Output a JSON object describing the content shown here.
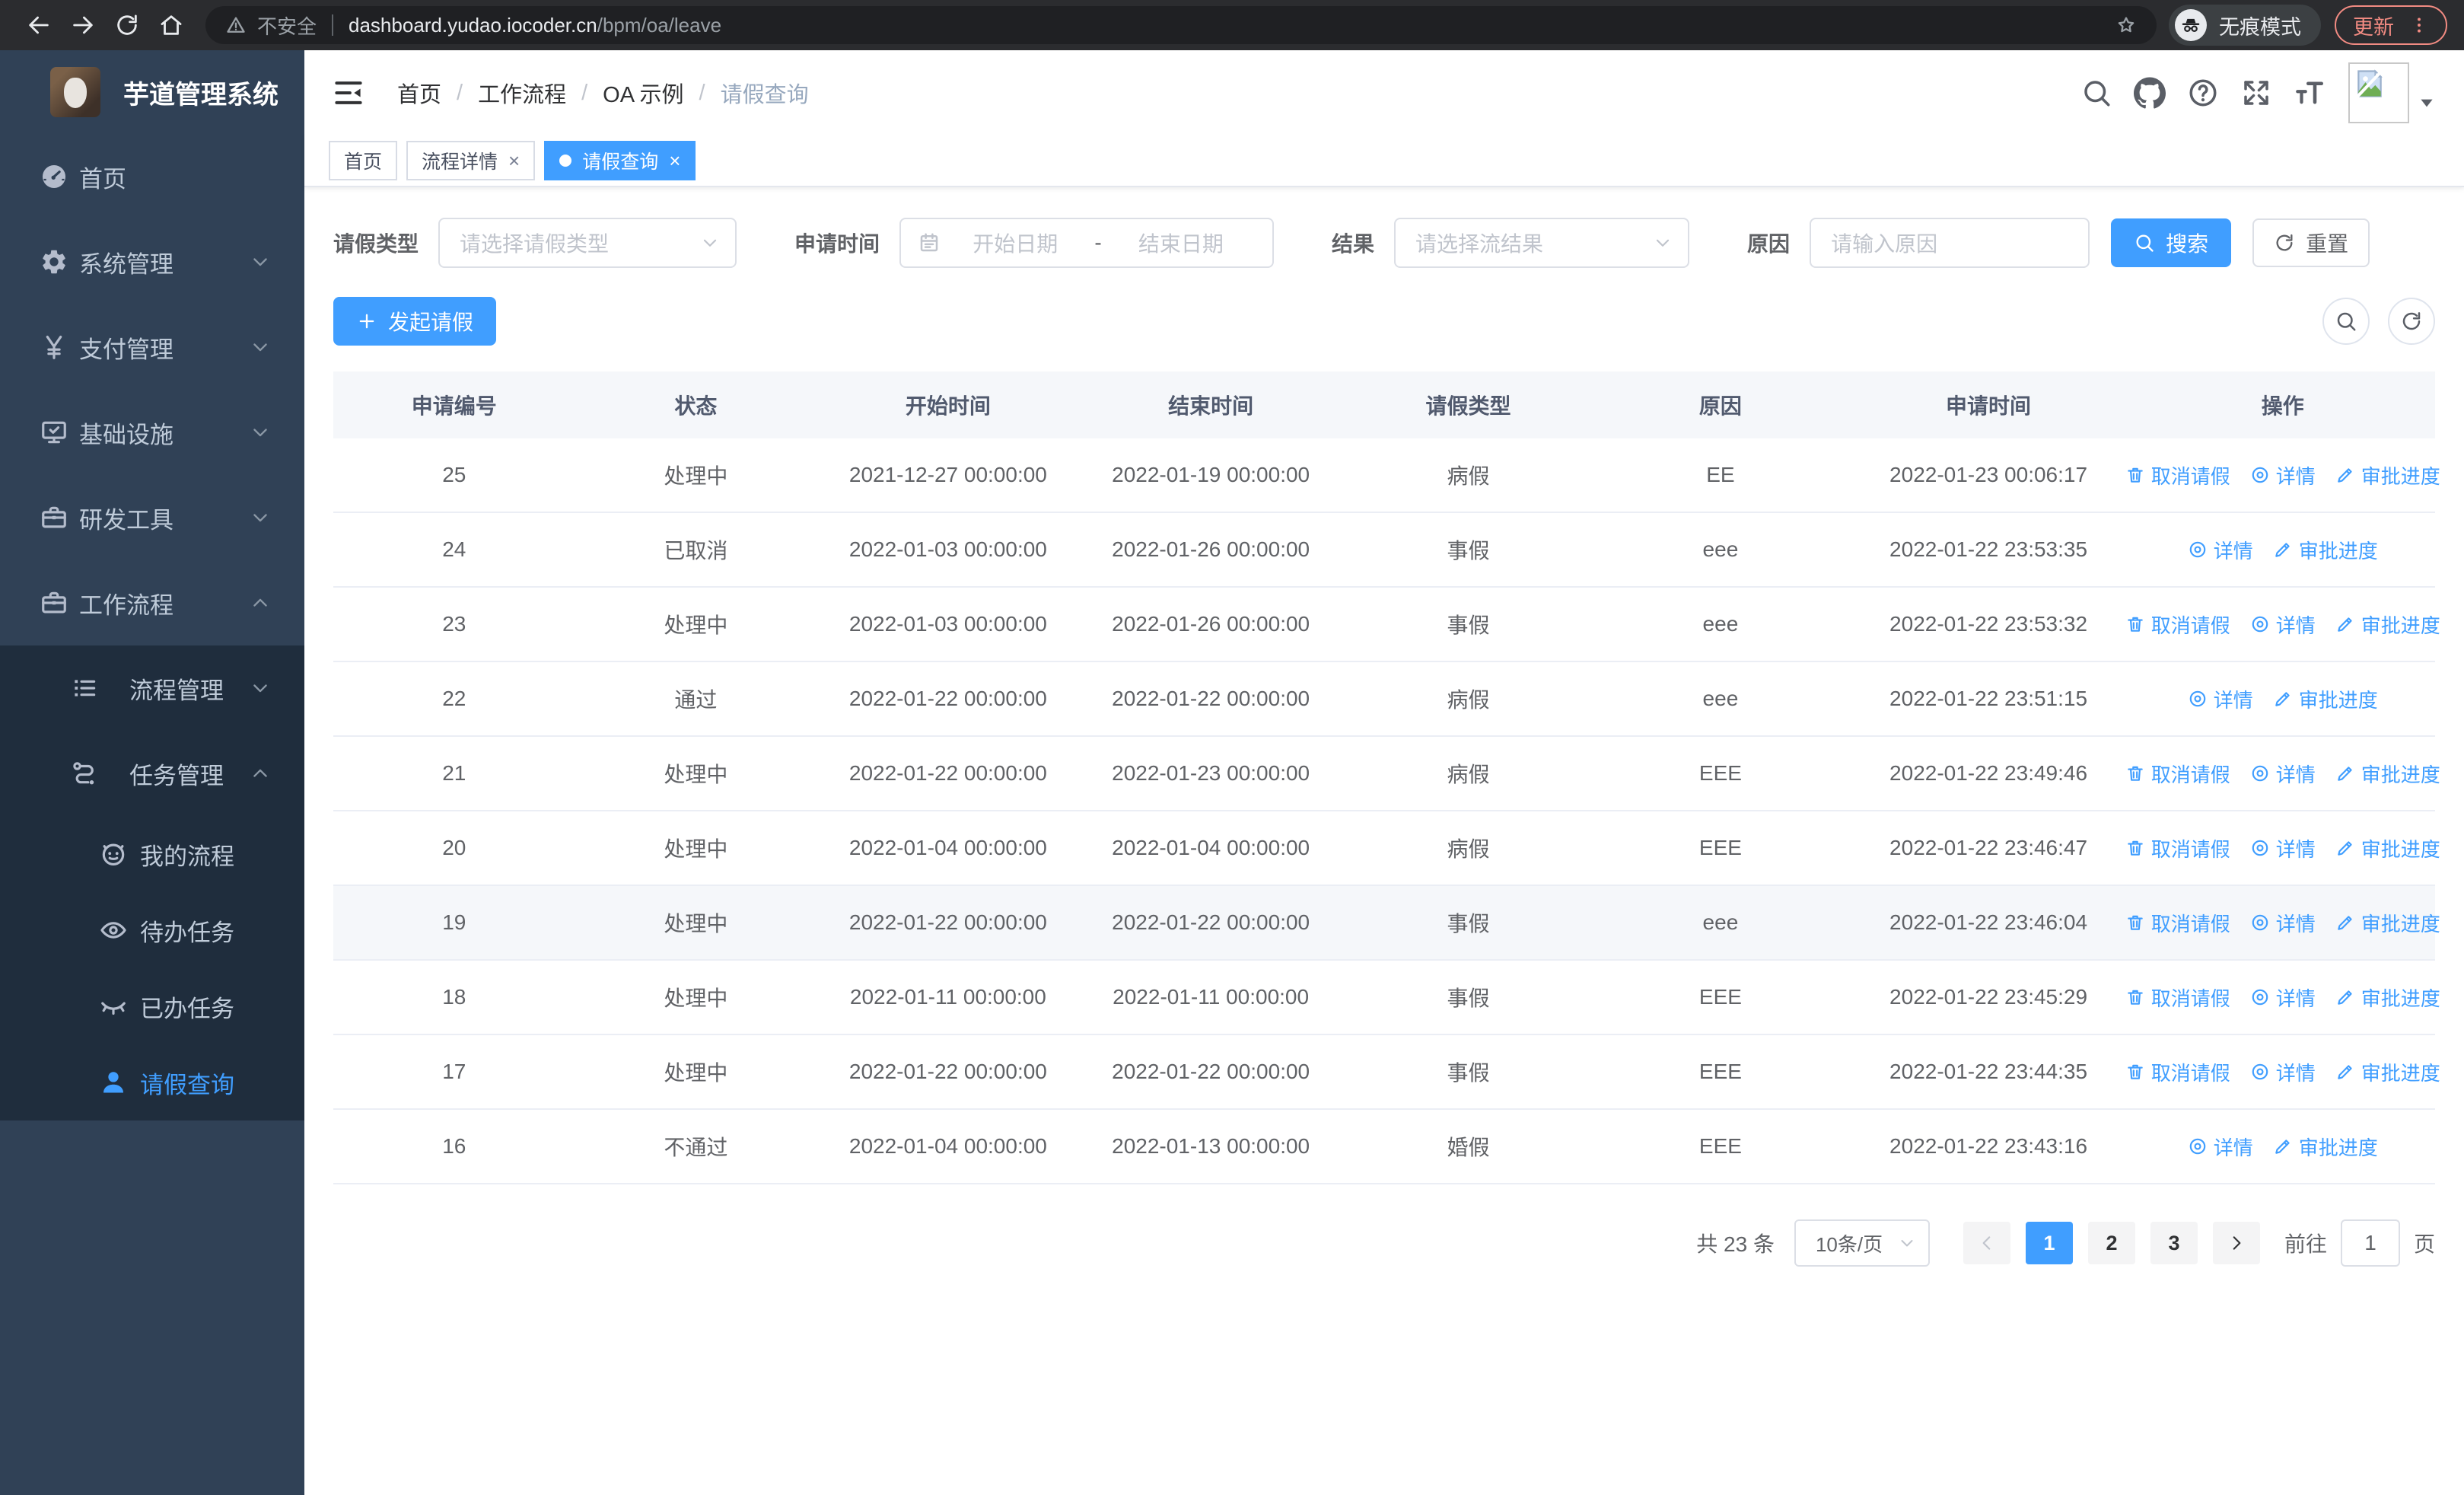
{
  "colors": {
    "accent": "#409eff",
    "sidebar_bg": "#304156",
    "submenu_bg": "#1f2d3d",
    "chrome_bg": "#2b2c2f",
    "update_color": "#f28b82",
    "table_border": "#ebeef5",
    "header_row_bg": "#f5f7fa"
  },
  "browser": {
    "security_label": "不安全",
    "url_domain": "dashboard.yudao.iocoder.cn",
    "url_path": "/bpm/oa/leave",
    "incognito_label": "无痕模式",
    "update_label": "更新"
  },
  "sidebar": {
    "title": "芋道管理系统",
    "items": [
      {
        "label": "首页",
        "icon": "dashboard-icon",
        "level": 1
      },
      {
        "label": "系统管理",
        "icon": "gear-icon",
        "level": 1,
        "chevron": "down"
      },
      {
        "label": "支付管理",
        "icon": "yen-icon",
        "level": 1,
        "chevron": "down"
      },
      {
        "label": "基础设施",
        "icon": "monitor-icon",
        "level": 1,
        "chevron": "down"
      },
      {
        "label": "研发工具",
        "icon": "toolbox-icon",
        "level": 1,
        "chevron": "down"
      },
      {
        "label": "工作流程",
        "icon": "briefcase-icon",
        "level": 1,
        "chevron": "up"
      },
      {
        "label": "流程管理",
        "icon": "list-tree-icon",
        "level": 2,
        "chevron": "down",
        "dark": true
      },
      {
        "label": "任务管理",
        "icon": "flow-icon",
        "level": 2,
        "chevron": "up",
        "dark": true
      },
      {
        "label": "我的流程",
        "icon": "robot-icon",
        "level": 3,
        "dark": true
      },
      {
        "label": "待办任务",
        "icon": "eye-open-icon",
        "level": 3,
        "dark": true
      },
      {
        "label": "已办任务",
        "icon": "eye-closed-icon",
        "level": 3,
        "dark": true
      },
      {
        "label": "请假查询",
        "icon": "user-icon",
        "level": 3,
        "dark": true,
        "active": true
      }
    ]
  },
  "navbar": {
    "breadcrumb": [
      "首页",
      "工作流程",
      "OA 示例",
      "请假查询"
    ]
  },
  "tabs": [
    {
      "label": "首页"
    },
    {
      "label": "流程详情",
      "closable": true
    },
    {
      "label": "请假查询",
      "closable": true,
      "active": true
    }
  ],
  "filters": {
    "leave_type_label": "请假类型",
    "leave_type_placeholder": "请选择请假类型",
    "apply_time_label": "申请时间",
    "start_placeholder": "开始日期",
    "range_separator": "-",
    "end_placeholder": "结束日期",
    "result_label": "结果",
    "result_placeholder": "请选择流结果",
    "reason_label": "原因",
    "reason_placeholder": "请输入原因",
    "search_label": "搜索",
    "reset_label": "重置"
  },
  "toolbar": {
    "create_label": "发起请假"
  },
  "table": {
    "columns": [
      "申请编号",
      "状态",
      "开始时间",
      "结束时间",
      "请假类型",
      "原因",
      "申请时间",
      "操作"
    ],
    "action_labels": {
      "cancel": "取消请假",
      "detail": "详情",
      "progress": "审批进度"
    },
    "rows": [
      {
        "id": "25",
        "status": "处理中",
        "start": "2021-12-27 00:00:00",
        "end": "2022-01-19 00:00:00",
        "type": "病假",
        "reason": "EE",
        "apply": "2022-01-23 00:06:17",
        "actions": [
          "cancel",
          "detail",
          "progress"
        ]
      },
      {
        "id": "24",
        "status": "已取消",
        "start": "2022-01-03 00:00:00",
        "end": "2022-01-26 00:00:00",
        "type": "事假",
        "reason": "eee",
        "apply": "2022-01-22 23:53:35",
        "actions": [
          "detail",
          "progress"
        ]
      },
      {
        "id": "23",
        "status": "处理中",
        "start": "2022-01-03 00:00:00",
        "end": "2022-01-26 00:00:00",
        "type": "事假",
        "reason": "eee",
        "apply": "2022-01-22 23:53:32",
        "actions": [
          "cancel",
          "detail",
          "progress"
        ]
      },
      {
        "id": "22",
        "status": "通过",
        "start": "2022-01-22 00:00:00",
        "end": "2022-01-22 00:00:00",
        "type": "病假",
        "reason": "eee",
        "apply": "2022-01-22 23:51:15",
        "actions": [
          "detail",
          "progress"
        ]
      },
      {
        "id": "21",
        "status": "处理中",
        "start": "2022-01-22 00:00:00",
        "end": "2022-01-23 00:00:00",
        "type": "病假",
        "reason": "EEE",
        "apply": "2022-01-22 23:49:46",
        "actions": [
          "cancel",
          "detail",
          "progress"
        ]
      },
      {
        "id": "20",
        "status": "处理中",
        "start": "2022-01-04 00:00:00",
        "end": "2022-01-04 00:00:00",
        "type": "病假",
        "reason": "EEE",
        "apply": "2022-01-22 23:46:47",
        "actions": [
          "cancel",
          "detail",
          "progress"
        ]
      },
      {
        "id": "19",
        "status": "处理中",
        "start": "2022-01-22 00:00:00",
        "end": "2022-01-22 00:00:00",
        "type": "事假",
        "reason": "eee",
        "apply": "2022-01-22 23:46:04",
        "actions": [
          "cancel",
          "detail",
          "progress"
        ],
        "highlighted": true
      },
      {
        "id": "18",
        "status": "处理中",
        "start": "2022-01-11 00:00:00",
        "end": "2022-01-11 00:00:00",
        "type": "事假",
        "reason": "EEE",
        "apply": "2022-01-22 23:45:29",
        "actions": [
          "cancel",
          "detail",
          "progress"
        ]
      },
      {
        "id": "17",
        "status": "处理中",
        "start": "2022-01-22 00:00:00",
        "end": "2022-01-22 00:00:00",
        "type": "事假",
        "reason": "EEE",
        "apply": "2022-01-22 23:44:35",
        "actions": [
          "cancel",
          "detail",
          "progress"
        ]
      },
      {
        "id": "16",
        "status": "不通过",
        "start": "2022-01-04 00:00:00",
        "end": "2022-01-13 00:00:00",
        "type": "婚假",
        "reason": "EEE",
        "apply": "2022-01-22 23:43:16",
        "actions": [
          "detail",
          "progress"
        ]
      }
    ]
  },
  "pagination": {
    "total_label": "共 23 条",
    "page_size": "10条/页",
    "pages": [
      "1",
      "2",
      "3"
    ],
    "active_page": "1",
    "goto_label": "前往",
    "goto_value": "1",
    "page_suffix": "页"
  }
}
